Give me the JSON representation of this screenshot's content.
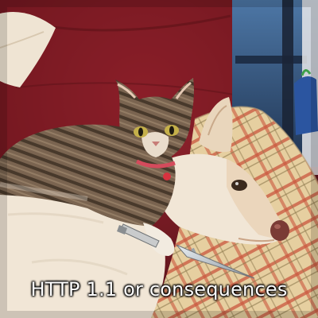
{
  "meme": {
    "caption": "HTTP 1.1 or consequences"
  },
  "colors": {
    "couch_red": "#8a1f26",
    "couch_red_dark": "#5c1218",
    "plaid_base": "#e6cfa0",
    "plaid_line": "#c9573e",
    "dog_fur": "#f1e6d6",
    "cat_tabby": "#7a6450",
    "cat_stripe": "#3c2e22",
    "caption_text": "#ffffff"
  }
}
